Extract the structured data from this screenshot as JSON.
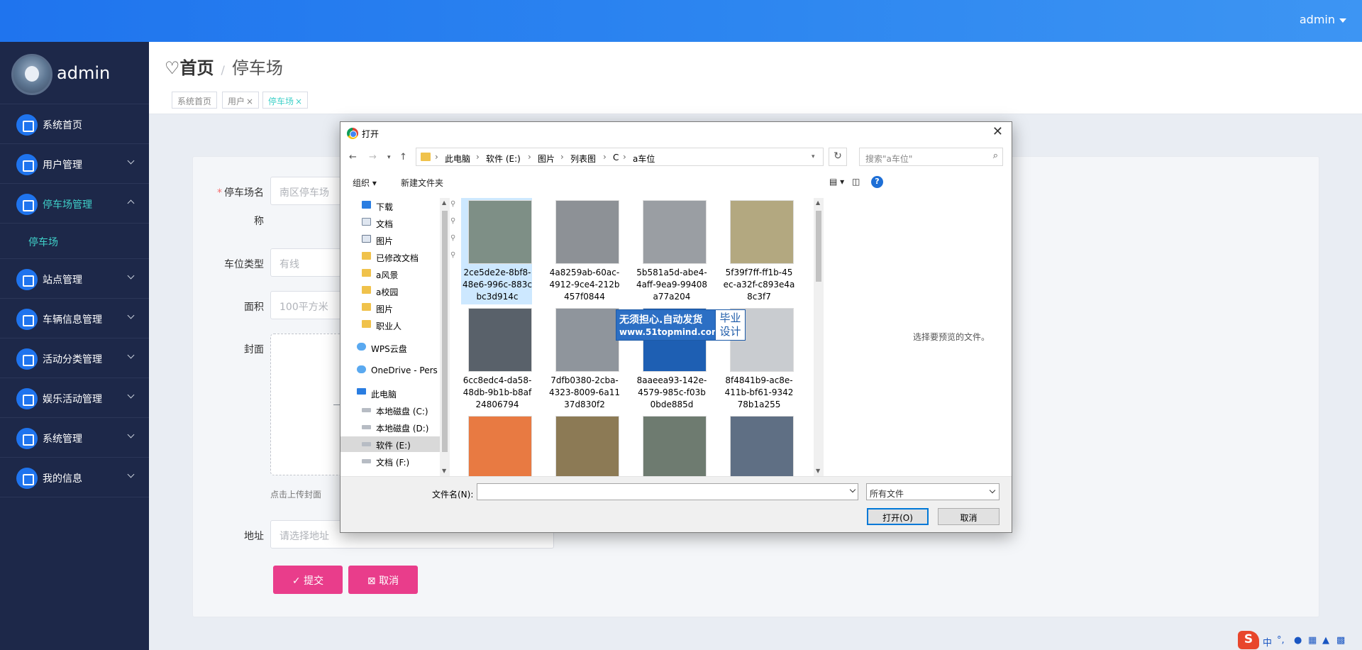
{
  "topbar": {
    "user_label": "admin"
  },
  "sidebar": {
    "profile_name": "admin",
    "items": [
      {
        "label": "系统首页",
        "icon": "home-icon",
        "expandable": false
      },
      {
        "label": "用户管理",
        "icon": "bulb-icon",
        "expandable": true
      },
      {
        "label": "停车场管理",
        "icon": "grid-icon",
        "expandable": true,
        "active": true
      },
      {
        "label": "站点管理",
        "icon": "user-icon",
        "expandable": true
      },
      {
        "label": "车辆信息管理",
        "icon": "grid-icon",
        "expandable": true
      },
      {
        "label": "活动分类管理",
        "icon": "grid-icon",
        "expandable": true
      },
      {
        "label": "娱乐活动管理",
        "icon": "apps-icon",
        "expandable": true
      },
      {
        "label": "系统管理",
        "icon": "thumb-icon",
        "expandable": true
      },
      {
        "label": "我的信息",
        "icon": "card-icon",
        "expandable": true
      }
    ],
    "sub_item": "停车场"
  },
  "breadcrumb": {
    "home": "首页",
    "separator": "/",
    "current": "停车场"
  },
  "tabs": [
    {
      "label": "系统首页",
      "closable": false
    },
    {
      "label": "用户",
      "closable": true
    },
    {
      "label": "停车场",
      "closable": true,
      "active": true
    }
  ],
  "form": {
    "name_label_line1": "停车场名",
    "name_label_line2": "称",
    "name_placeholder": "南区停车场",
    "type_label": "车位类型",
    "type_placeholder": "有线",
    "area_label": "面积",
    "area_placeholder": "100平方米",
    "cover_label": "封面",
    "upload_hint": "点击上传封面",
    "address_label": "地址",
    "address_placeholder": "请选择地址",
    "submit": "提交",
    "cancel": "取消"
  },
  "dialog": {
    "title": "打开",
    "close": "✕",
    "path": [
      "此电脑",
      "软件 (E:)",
      "图片",
      "列表图",
      "C",
      "a车位"
    ],
    "search_placeholder": "搜索\"a车位\"",
    "organize": "组织 ▾",
    "new_folder": "新建文件夹",
    "help": "?",
    "nav": [
      {
        "label": "下载",
        "icon": "download",
        "pinned": true
      },
      {
        "label": "文档",
        "icon": "doc",
        "pinned": true
      },
      {
        "label": "图片",
        "icon": "pic",
        "pinned": true
      },
      {
        "label": "已修改文档",
        "icon": "folder",
        "pinned": true
      },
      {
        "label": "a风景",
        "icon": "folder"
      },
      {
        "label": "a校园",
        "icon": "folder"
      },
      {
        "label": "图片",
        "icon": "folder"
      },
      {
        "label": "职业人",
        "icon": "folder"
      },
      {
        "label": "WPS云盘",
        "icon": "cloud"
      },
      {
        "label": "OneDrive - Pers",
        "icon": "cloud"
      },
      {
        "label": "此电脑",
        "icon": "pc"
      },
      {
        "label": "本地磁盘 (C:)",
        "icon": "disk"
      },
      {
        "label": "本地磁盘 (D:)",
        "icon": "disk"
      },
      {
        "label": "软件 (E:)",
        "icon": "disk",
        "selected": true
      },
      {
        "label": "文档 (F:)",
        "icon": "disk"
      }
    ],
    "files": [
      {
        "name": "2ce5de2e-8bf8-48e6-996c-883cbc3d914c",
        "color": "#7e8f86",
        "selected": true
      },
      {
        "name": "4a8259ab-60ac-4912-9ce4-212b457f0844",
        "color": "#8d9196"
      },
      {
        "name": "5b581a5d-abe4-4aff-9ea9-99408a77a204",
        "color": "#9a9ea3"
      },
      {
        "name": "5f39f7ff-ff1b-45ec-a32f-c893e4a8c3f7",
        "color": "#b3a880"
      },
      {
        "name": "6cc8edc4-da58-48db-9b1b-b8af24806794",
        "color": "#59616a"
      },
      {
        "name": "7dfb0380-2cba-4323-8009-6a1137d830f2",
        "color": "#8f959c"
      },
      {
        "name": "8aaeea93-142e-4579-985c-f03b0bde885d",
        "color": "#1e5fb3"
      },
      {
        "name": "8f4841b9-ac8e-411b-bf61-934278b1a255",
        "color": "#c9ccd0"
      },
      {
        "name": "",
        "color": "#e87a42"
      },
      {
        "name": "",
        "color": "#8c7a55"
      },
      {
        "name": "",
        "color": "#6e7b70"
      },
      {
        "name": "",
        "color": "#5f6f84"
      }
    ],
    "preview_text": "选择要预览的文件。",
    "filename_label": "文件名(N):",
    "filename_value": "",
    "filetype": "所有文件",
    "open_btn": "打开(O)",
    "cancel_btn": "取消"
  },
  "watermark": {
    "line1": "无须担心.自动发货",
    "line2": "www.51topmind.com",
    "box1": "毕业",
    "box2": "设计"
  },
  "tray": {
    "ime_label": "中"
  }
}
